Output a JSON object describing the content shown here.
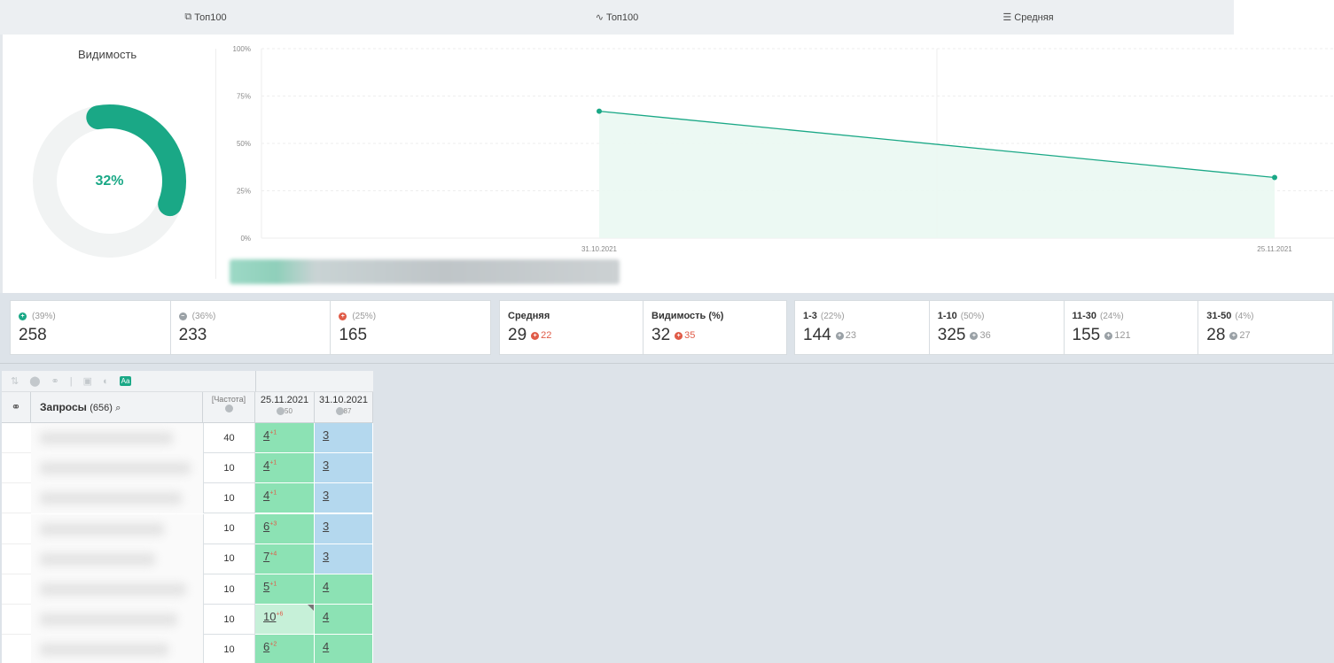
{
  "tabs": [
    {
      "label": "Топ100",
      "icon": "layers-icon"
    },
    {
      "label": "Топ100",
      "icon": "pulse-icon"
    },
    {
      "label": "Средняя",
      "icon": "list-icon"
    }
  ],
  "visibility": {
    "title": "Видимость",
    "percent_label": "32%",
    "percent": 32,
    "accent": "#1aa886"
  },
  "chart_data": {
    "type": "area",
    "x": [
      "31.10.2021",
      "25.11.2021"
    ],
    "series": [
      {
        "values": [
          67,
          32
        ]
      }
    ],
    "y_ticks": [
      "0%",
      "25%",
      "50%",
      "75%",
      "100%"
    ],
    "ylim": [
      0,
      100
    ],
    "grid": true,
    "color": "#1aa886"
  },
  "stats_left": [
    {
      "icon": "plus-circle-icon",
      "pct": "(39%)",
      "value": "258",
      "color": "green"
    },
    {
      "icon": "minus-circle-icon",
      "pct": "(36%)",
      "value": "233",
      "color": "gray"
    },
    {
      "icon": "plus-circle-icon",
      "pct": "(25%)",
      "value": "165",
      "color": "red"
    }
  ],
  "stats_mid": [
    {
      "label": "Средняя",
      "value": "29",
      "delta": "22"
    },
    {
      "label": "Видимость (%)",
      "value": "32",
      "delta": "35"
    }
  ],
  "stats_right": [
    {
      "label": "1-3",
      "pct": "(22%)",
      "value": "144",
      "delta": "23"
    },
    {
      "label": "1-10",
      "pct": "(50%)",
      "value": "325",
      "delta": "36"
    },
    {
      "label": "11-30",
      "pct": "(24%)",
      "value": "155",
      "delta": "121"
    },
    {
      "label": "31-50",
      "pct": "(4%)",
      "value": "28",
      "delta": "27"
    }
  ],
  "table": {
    "query_header": "Запросы",
    "query_count": "(656)",
    "freq_header": "[Частота]",
    "dates": [
      {
        "date": "25.11.2021",
        "sub": "50"
      },
      {
        "date": "31.10.2021",
        "sub": "87"
      }
    ],
    "rows": [
      {
        "freq": "40",
        "p1": "4",
        "p1d": "+1",
        "p1c": "green",
        "p2": "3",
        "p2c": "blue"
      },
      {
        "freq": "10",
        "p1": "4",
        "p1d": "+1",
        "p1c": "green",
        "p2": "3",
        "p2c": "blue"
      },
      {
        "freq": "10",
        "p1": "4",
        "p1d": "+1",
        "p1c": "green",
        "p2": "3",
        "p2c": "blue"
      },
      {
        "freq": "10",
        "p1": "6",
        "p1d": "+3",
        "p1c": "green",
        "p2": "3",
        "p2c": "blue"
      },
      {
        "freq": "10",
        "p1": "7",
        "p1d": "+4",
        "p1c": "green",
        "p2": "3",
        "p2c": "blue"
      },
      {
        "freq": "10",
        "p1": "5",
        "p1d": "+1",
        "p1c": "green",
        "p2": "4",
        "p2c": "green"
      },
      {
        "freq": "10",
        "p1": "10",
        "p1d": "+6",
        "p1c": "lightgreen",
        "p2": "4",
        "p2c": "green"
      },
      {
        "freq": "10",
        "p1": "6",
        "p1d": "+2",
        "p1c": "green",
        "p2": "4",
        "p2c": "green"
      }
    ]
  }
}
